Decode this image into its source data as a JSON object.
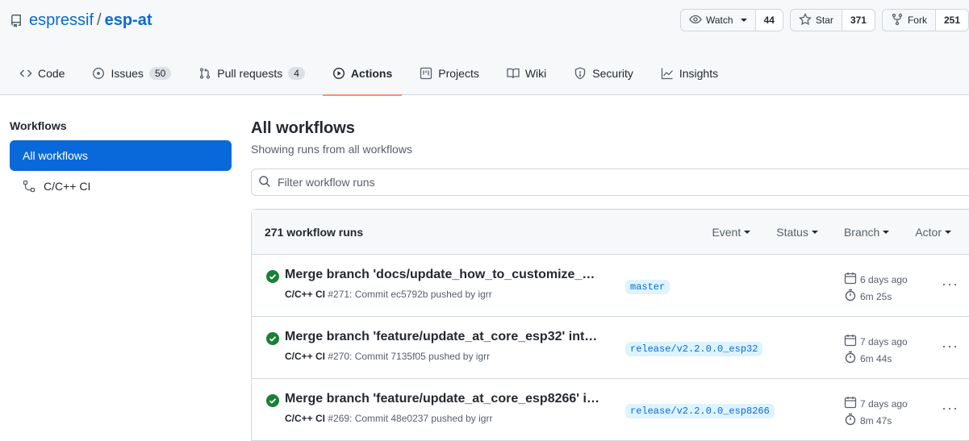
{
  "repo": {
    "owner": "espressif",
    "separator": "/",
    "name": "esp-at"
  },
  "header_buttons": {
    "watch": {
      "label": "Watch",
      "count": "44"
    },
    "star": {
      "label": "Star",
      "count": "371"
    },
    "fork": {
      "label": "Fork",
      "count": "251"
    }
  },
  "tabs": [
    {
      "label": "Code",
      "icon": "code-icon"
    },
    {
      "label": "Issues",
      "count": "50",
      "icon": "issue-icon"
    },
    {
      "label": "Pull requests",
      "count": "4",
      "icon": "pull-request-icon"
    },
    {
      "label": "Actions",
      "icon": "play-icon",
      "active": true
    },
    {
      "label": "Projects",
      "icon": "project-icon"
    },
    {
      "label": "Wiki",
      "icon": "book-icon"
    },
    {
      "label": "Security",
      "icon": "shield-icon"
    },
    {
      "label": "Insights",
      "icon": "graph-icon"
    }
  ],
  "sidebar": {
    "heading": "Workflows",
    "items": [
      {
        "label": "All workflows",
        "active": true
      },
      {
        "label": "C/C++ CI",
        "icon": "workflow-icon"
      }
    ]
  },
  "main": {
    "title": "All workflows",
    "subtitle": "Showing runs from all workflows",
    "filter_placeholder": "Filter workflow runs",
    "runs_count": "271 workflow runs",
    "filters": [
      "Event",
      "Status",
      "Branch",
      "Actor"
    ]
  },
  "runs": [
    {
      "title": "Merge branch 'docs/update_how_to_customize_…",
      "workflow": "C/C++ CI",
      "detail": " #271: Commit ec5792b pushed by igrr",
      "branch": "master",
      "when": "6 days ago",
      "duration": "6m 25s"
    },
    {
      "title": "Merge branch 'feature/update_at_core_esp32' int…",
      "workflow": "C/C++ CI",
      "detail": " #270: Commit 7135f05 pushed by igrr",
      "branch": "release/v2.2.0.0_esp32",
      "when": "7 days ago",
      "duration": "6m 44s"
    },
    {
      "title": "Merge branch 'feature/update_at_core_esp8266' i…",
      "workflow": "C/C++ CI",
      "detail": " #269: Commit 48e0237 pushed by igrr",
      "branch": "release/v2.2.0.0_esp8266",
      "when": "7 days ago",
      "duration": "8m 47s"
    }
  ],
  "colors": {
    "accent": "#0969da",
    "success": "#1a7f37",
    "tab_underline": "#fd8c73"
  }
}
